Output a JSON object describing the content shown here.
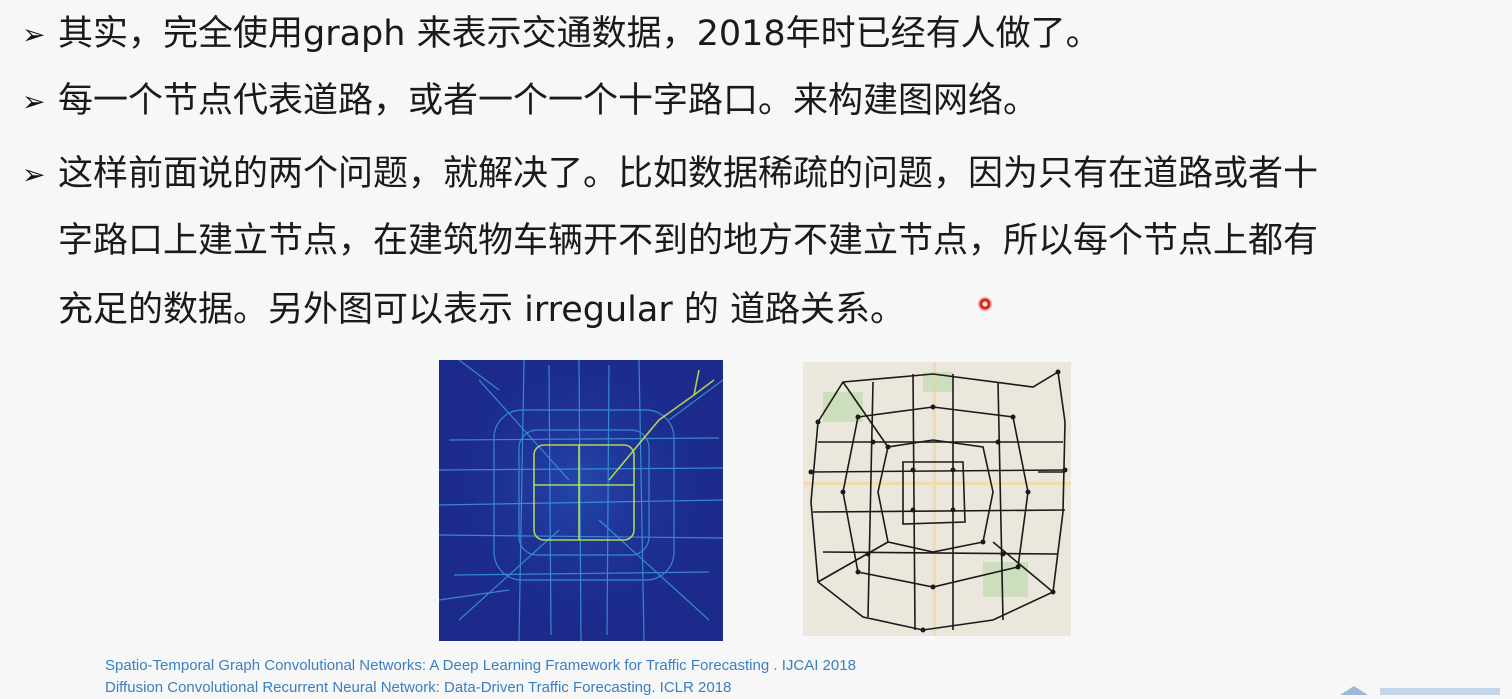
{
  "bullets": [
    {
      "lines": [
        "其实，完全使用graph 来表示交通数据，2018年时已经有人做了。"
      ]
    },
    {
      "lines": [
        "每一个节点代表道路，或者一个一个十字路口。来构建图网络。"
      ]
    },
    {
      "lines": [
        "这样前面说的两个问题，就解决了。比如数据稀疏的问题，因为只有在道路或者十",
        "字路口上建立节点，在建筑物车辆开不到的地方不建立节点，所以每个节点上都有",
        "充足的数据。另外图可以表示 irregular 的 道路关系。"
      ]
    }
  ],
  "bullet_marker": "➢",
  "references": [
    "Spatio-Temporal Graph Convolutional Networks: A Deep Learning Framework for Traffic Forecasting .  IJCAI 2018",
    "Diffusion Convolutional Recurrent Neural Network: Data-Driven Traffic Forecasting.   ICLR 2018"
  ],
  "colors": {
    "text": "#1a1a1a",
    "reference": "#3a7fc4",
    "heatmap_bg": "#1c2a8c",
    "heatmap_road": "#3fa7e0",
    "heatmap_hot": "#c8f04a",
    "map_bg": "#ece7dc",
    "graph_edge": "#1a1a1a",
    "laser": "#e0201a"
  }
}
